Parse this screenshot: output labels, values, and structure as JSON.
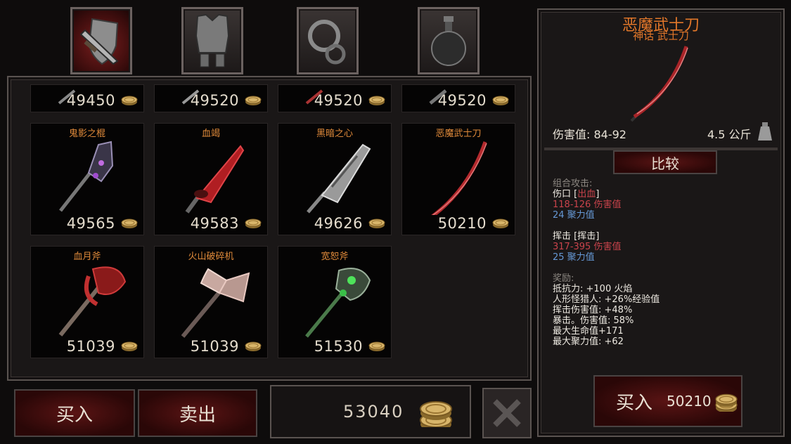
{
  "tabs": [
    {
      "name": "weapons-tab",
      "icon": "sword-shield-icon",
      "active": true
    },
    {
      "name": "armor-tab",
      "icon": "armor-icon",
      "active": false
    },
    {
      "name": "rings-tab",
      "icon": "ring-icon",
      "active": false
    },
    {
      "name": "potions-tab",
      "icon": "potion-icon",
      "active": false
    }
  ],
  "grid": {
    "top_row_prices": [
      "49450",
      "49520",
      "49520",
      "49520"
    ],
    "items": [
      {
        "name": "鬼影之棍",
        "price": "49565",
        "icon": "purple-mace-icon"
      },
      {
        "name": "血竭",
        "price": "49583",
        "icon": "red-blade-icon"
      },
      {
        "name": "黑暗之心",
        "price": "49626",
        "icon": "silver-sword-icon"
      },
      {
        "name": "恶魔武士刀",
        "price": "50210",
        "icon": "katana-icon"
      },
      {
        "name": "血月斧",
        "price": "51039",
        "icon": "red-axe-icon"
      },
      {
        "name": "火山破碎机",
        "price": "51039",
        "icon": "double-axe-icon"
      },
      {
        "name": "宽恕斧",
        "price": "51530",
        "icon": "green-axe-icon"
      }
    ]
  },
  "buttons": {
    "buy": "买入",
    "sell": "卖出",
    "close_icon": "close-x-icon"
  },
  "gold": "53040",
  "detail": {
    "title": "恶魔武士刀",
    "subtitle": "神话 武士刀",
    "damage_label": "伤害值: 84-92",
    "weight": "4.5 公斤",
    "compare": "比较",
    "combo_header": "组合攻击:",
    "combo1_name": "伤口 [",
    "combo1_effect": "出血",
    "combo1_close": "]",
    "combo1_damage": "118-126 伤害值",
    "combo1_focus": "24 聚力值",
    "combo2_name": "挥击 [挥击]",
    "combo2_damage": "317-395 伤害值",
    "combo2_focus": "25 聚力值",
    "bonus_header": "奖励:",
    "bonuses": [
      "抵抗力:  +100 火焰",
      "人形怪猎人:  +26%经验值",
      "挥击伤害值:  +48%",
      "暴击。伤害值:  58%",
      "最大生命值+171",
      "最大聚力值:  +62"
    ],
    "buy_label": "买入",
    "buy_price": "50210"
  },
  "colors": {
    "accent_red": "#7a1e1e",
    "name_orange": "#e08a3a",
    "damage_red": "#c9434b",
    "focus_blue": "#6699d6"
  }
}
